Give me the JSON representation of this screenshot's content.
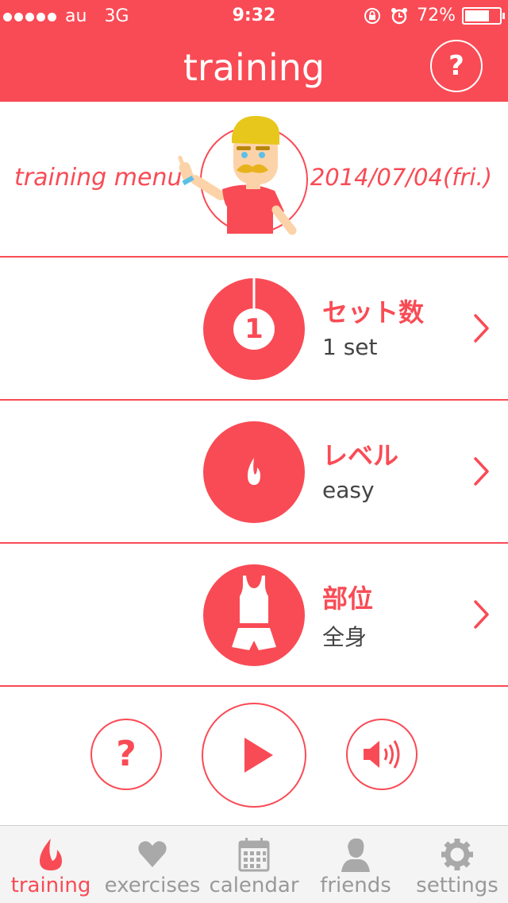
{
  "status_bar": {
    "carrier": "au",
    "network": "3G",
    "time": "9:32",
    "battery": "72%",
    "battery_level": 0.72
  },
  "nav": {
    "title": "training",
    "help_label": "?"
  },
  "header": {
    "menu_label": "training menu",
    "date": "2014/07/04(fri.)"
  },
  "options": [
    {
      "label": "セット数",
      "value": "1 set",
      "badge": "1",
      "icon": "set-count-icon"
    },
    {
      "label": "レベル",
      "value": "easy",
      "icon": "flame-icon"
    },
    {
      "label": "部位",
      "value": "全身",
      "icon": "body-clothes-icon"
    }
  ],
  "controls": {
    "help_label": "?",
    "play_icon": "play-icon",
    "sound_icon": "speaker-icon"
  },
  "tabs": [
    {
      "label": "training",
      "icon": "flame-icon",
      "active": true
    },
    {
      "label": "exercises",
      "icon": "heart-icon",
      "active": false
    },
    {
      "label": "calendar",
      "icon": "calendar-icon",
      "active": false
    },
    {
      "label": "friends",
      "icon": "person-icon",
      "active": false
    },
    {
      "label": "settings",
      "icon": "gear-icon",
      "active": false
    }
  ],
  "colors": {
    "accent": "#f94b55",
    "tab_inactive": "#999999",
    "tab_bar_bg": "#f4f4f4"
  }
}
